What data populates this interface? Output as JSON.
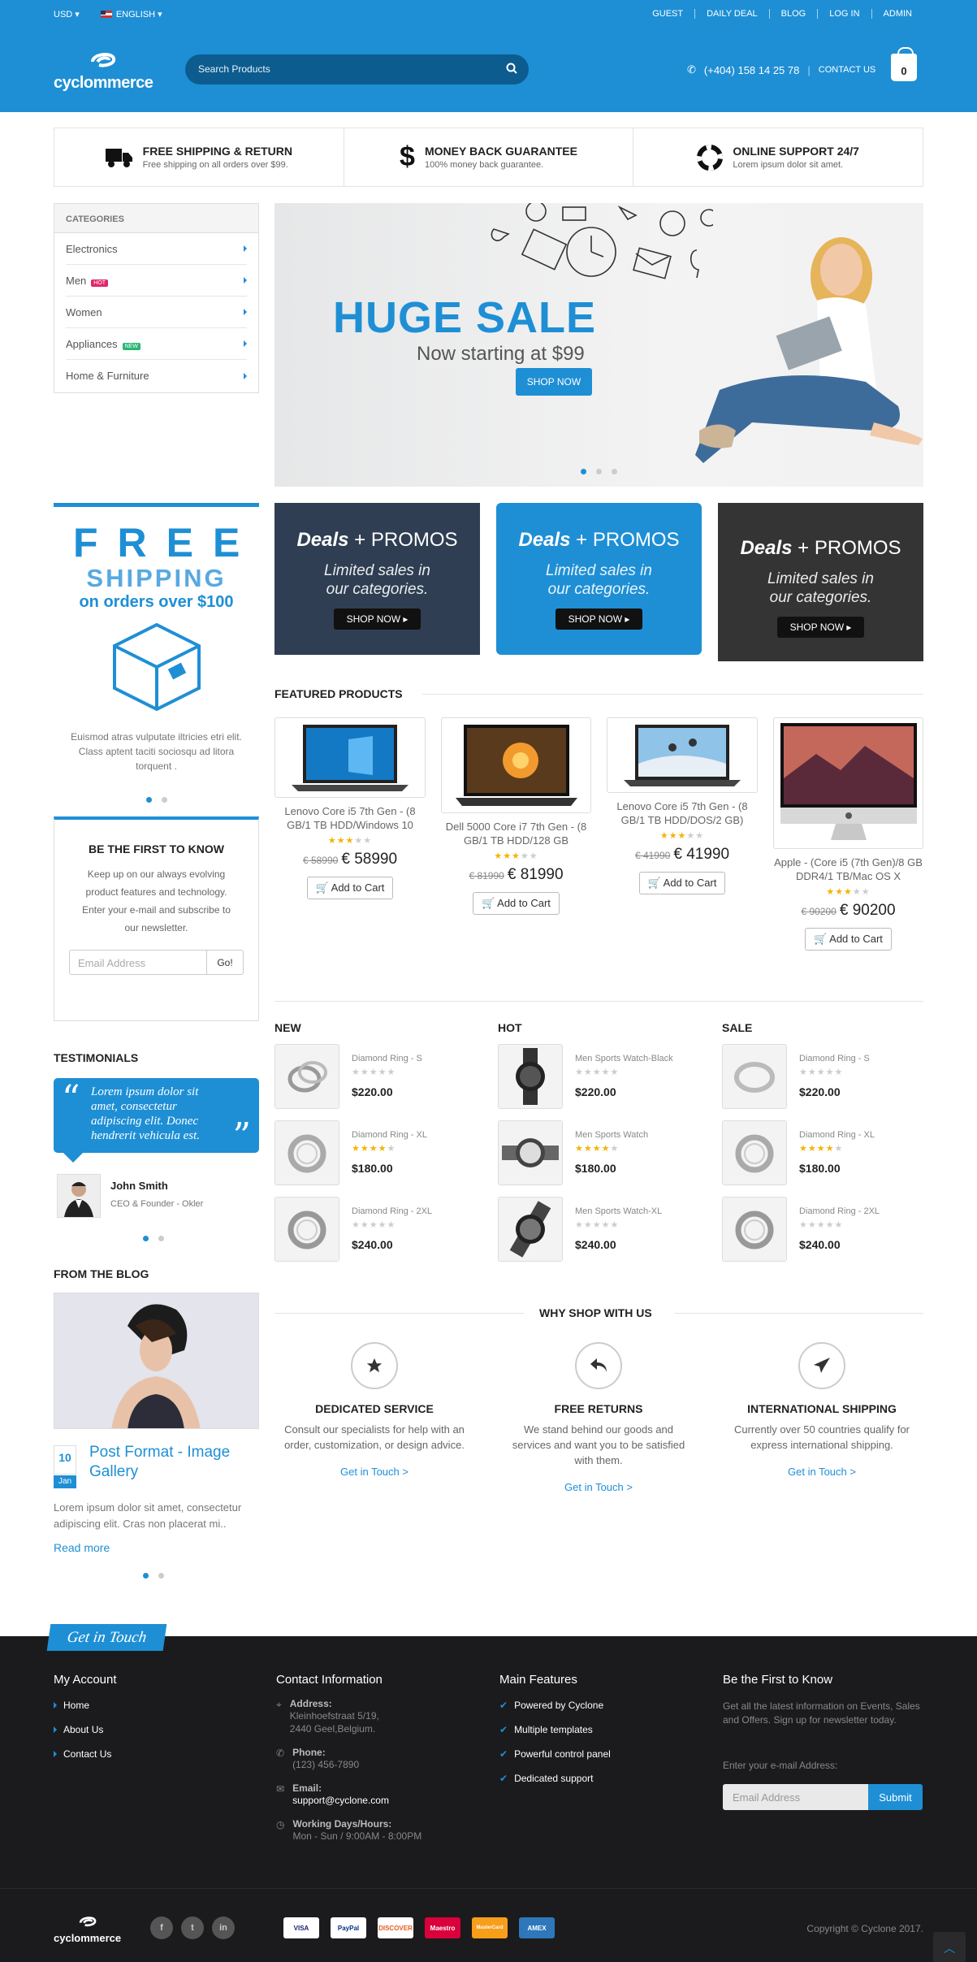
{
  "topbar": {
    "currency": "USD",
    "language": "ENGLISH",
    "links": [
      "GUEST",
      "DAILY DEAL",
      "BLOG",
      "LOG IN",
      "ADMIN"
    ]
  },
  "header": {
    "logo": "cyclommerce",
    "search_placeholder": "Search Products",
    "phone": "(+404) 158 14 25 78",
    "contact": "CONTACT US",
    "cart_count": "0"
  },
  "features": [
    {
      "title": "FREE SHIPPING & RETURN",
      "sub": "Free shipping on all orders over $99.",
      "icon": "truck-icon"
    },
    {
      "title": "MONEY BACK GUARANTEE",
      "sub": "100% money back guarantee.",
      "icon": "dollar-icon"
    },
    {
      "title": "ONLINE SUPPORT 24/7",
      "sub": "Lorem ipsum dolor sit amet.",
      "icon": "lifebuoy-icon"
    }
  ],
  "categories": {
    "title": "CATEGORIES",
    "items": [
      {
        "label": "Electronics",
        "badge": ""
      },
      {
        "label": "Men",
        "badge": "HOT"
      },
      {
        "label": "Women",
        "badge": ""
      },
      {
        "label": "Appliances",
        "badge": "NEW"
      },
      {
        "label": "Home & Furniture",
        "badge": ""
      }
    ]
  },
  "banner": {
    "title": "HUGE SALE",
    "subtitle": "Now starting at $99",
    "button": "SHOP NOW"
  },
  "freeship": {
    "line1": "FREE",
    "line2": "SHIPPING",
    "line3": "on orders over $100",
    "text": "Euismod atras vulputate iltricies etri elit. Class aptent taciti sociosqu ad litora torquent ."
  },
  "promos": [
    {
      "bold": "Deals",
      "rest": " + PROMOS",
      "text1": "Limited sales in",
      "text2": "our categories.",
      "button": "SHOP NOW"
    },
    {
      "bold": "Deals",
      "rest": " + PROMOS",
      "text1": "Limited sales in",
      "text2": "our categories.",
      "button": "SHOP NOW"
    },
    {
      "bold": "Deals",
      "rest": " + PROMOS",
      "text1": "Limited sales in",
      "text2": "our categories.",
      "button": "SHOP NOW"
    }
  ],
  "featured": {
    "title": "FEATURED PRODUCTS",
    "add_label": "Add to Cart",
    "products": [
      {
        "name": "Lenovo Core i5 7th Gen - (8 GB/1 TB HDD/Windows 10",
        "old": "€ 58990",
        "price": "€ 58990",
        "rating": 3
      },
      {
        "name": "Dell 5000 Core i7 7th Gen - (8 GB/1 TB HDD/128 GB",
        "old": "€ 81990",
        "price": "€ 81990",
        "rating": 3
      },
      {
        "name": "Lenovo Core i5 7th Gen - (8 GB/1 TB HDD/DOS/2 GB)",
        "old": "€ 41990",
        "price": "€ 41990",
        "rating": 3
      },
      {
        "name": "Apple - (Core i5 (7th Gen)/8 GB DDR4/1 TB/Mac OS X",
        "old": "€ 90200",
        "price": "€ 90200",
        "rating": 3
      }
    ]
  },
  "know": {
    "title": "BE THE FIRST TO KNOW",
    "text": "Keep up on our always evolving product features and technology. Enter your e-mail and subscribe to our newsletter.",
    "placeholder": "Email Address",
    "button": "Go!"
  },
  "lists": [
    {
      "title": "NEW",
      "items": [
        {
          "name": "Diamond Ring - S",
          "price": "$220.00",
          "rating": 0
        },
        {
          "name": "Diamond Ring - XL",
          "price": "$180.00",
          "rating": 4
        },
        {
          "name": "Diamond Ring - 2XL",
          "price": "$240.00",
          "rating": 0
        }
      ]
    },
    {
      "title": "HOT",
      "items": [
        {
          "name": "Men Sports Watch-Black",
          "price": "$220.00",
          "rating": 0
        },
        {
          "name": "Men Sports Watch",
          "price": "$180.00",
          "rating": 4
        },
        {
          "name": "Men Sports Watch-XL",
          "price": "$240.00",
          "rating": 0
        }
      ]
    },
    {
      "title": "SALE",
      "items": [
        {
          "name": "Diamond Ring - S",
          "price": "$220.00",
          "rating": 0
        },
        {
          "name": "Diamond Ring - XL",
          "price": "$180.00",
          "rating": 4
        },
        {
          "name": "Diamond Ring - 2XL",
          "price": "$240.00",
          "rating": 0
        }
      ]
    }
  ],
  "testimonials": {
    "title": "TESTIMONIALS",
    "quote": "Lorem ipsum dolor sit amet, consectetur adipiscing elit. Donec hendrerit vehicula est.",
    "name": "John Smith",
    "role": "CEO & Founder - Okler"
  },
  "blog": {
    "title": "FROM THE BLOG",
    "day": "10",
    "month": "Jan",
    "post_title": "Post Format - Image Gallery",
    "excerpt": "Lorem ipsum dolor sit amet, consectetur adipiscing elit. Cras non placerat mi..",
    "read_more": "Read more"
  },
  "why": {
    "title": "WHY SHOP WITH US",
    "items": [
      {
        "title": "DEDICATED SERVICE",
        "text": "Consult our specialists for help with an order, customization, or design advice.",
        "link": "Get in Touch >",
        "icon": "star-icon"
      },
      {
        "title": "FREE RETURNS",
        "text": "We stand behind our goods and services and want you to be satisfied with them.",
        "link": "Get in Touch >",
        "icon": "reply-icon"
      },
      {
        "title": "INTERNATIONAL SHIPPING",
        "text": "Currently over 50 countries qualify for express international shipping.",
        "link": "Get in Touch >",
        "icon": "paper-plane-icon"
      }
    ]
  },
  "footer": {
    "ribbon": "Get in Touch",
    "account": {
      "title": "My Account",
      "links": [
        "Home",
        "About Us",
        "Contact Us"
      ]
    },
    "contact": {
      "title": "Contact Information",
      "address_label": "Address:",
      "address1": "Kleinhoefstraat 5/19,",
      "address2": "2440 Geel,Belgium.",
      "phone_label": "Phone:",
      "phone": "(123) 456-7890",
      "email_label": "Email:",
      "email": "support@cyclone.com",
      "hours_label": "Working Days/Hours:",
      "hours": "Mon - Sun / 9:00AM - 8:00PM"
    },
    "features": {
      "title": "Main Features",
      "items": [
        "Powered by Cyclone",
        "Multiple templates",
        "Powerful control panel",
        "Dedicated support"
      ]
    },
    "newsletter": {
      "title": "Be the First to Know",
      "text": "Get all the latest information on Events, Sales and Offers. Sign up for newsletter today.",
      "label": "Enter your e-mail Address:",
      "placeholder": "Email Address",
      "button": "Submit"
    },
    "payments": [
      "VISA",
      "PayPal",
      "DISCOVER",
      "Maestro",
      "MasterCard",
      "AMEX"
    ],
    "social": [
      "f",
      "t",
      "in"
    ],
    "copyright": "Copyright © Cyclone 2017."
  },
  "colors": {
    "accent": "#1e8fd5",
    "dark": "#1b1b1d"
  }
}
